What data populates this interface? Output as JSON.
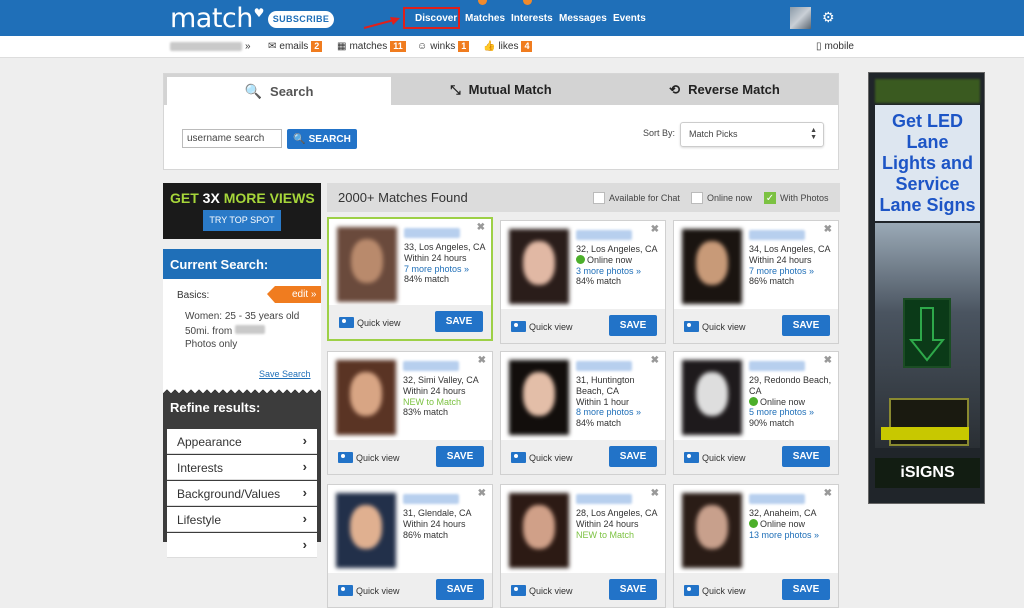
{
  "header": {
    "logo": "match",
    "subscribe": "SUBSCRIBE",
    "nav": [
      "Discover",
      "Matches",
      "Interests",
      "Messages",
      "Events"
    ]
  },
  "subnav": {
    "emails_label": "emails",
    "emails_count": "2",
    "matches_label": "matches",
    "matches_count": "11",
    "winks_label": "winks",
    "winks_count": "1",
    "likes_label": "likes",
    "likes_count": "4",
    "mobile": "mobile"
  },
  "search": {
    "tabs": [
      "Search",
      "Mutual Match",
      "Reverse Match"
    ],
    "username_placeholder": "username search",
    "button": "SEARCH",
    "sort_label": "Sort By:",
    "sort_value": "Match Picks"
  },
  "promo": {
    "headline_a": "GET",
    "headline_b": "3X",
    "headline_c": "MORE VIEWS",
    "button": "TRY TOP SPOT"
  },
  "current_search": {
    "title": "Current Search:",
    "basics": "Basics:",
    "edit": "edit »",
    "line1": "Women: 25 - 35 years old",
    "line2": "50mi. from",
    "line3": "Photos only",
    "save": "Save Search"
  },
  "refine": {
    "title": "Refine results:",
    "items": [
      "Appearance",
      "Interests",
      "Background/Values",
      "Lifestyle",
      ""
    ]
  },
  "results": {
    "count": "2000+ Matches Found",
    "filters": [
      "Available for Chat",
      "Online now",
      "With Photos"
    ],
    "quick_view": "Quick view",
    "save": "SAVE"
  },
  "cards": [
    {
      "a": "33, Los Angeles, CA",
      "b": "Within 24 hours",
      "c": "7 more photos »",
      "d": "84% match"
    },
    {
      "a": "32, Los Angeles, CA",
      "b": "Online now",
      "c": "3 more photos »",
      "d": "84% match"
    },
    {
      "a": "34, Los Angeles, CA",
      "b": "Within 24 hours",
      "c": "7 more photos »",
      "d": "86% match"
    },
    {
      "a": "32, Simi Valley, CA",
      "b": "Within 24 hours",
      "c": "NEW to Match",
      "d": "83% match"
    },
    {
      "a": "31, Huntington Beach, CA",
      "b": "Within 1 hour",
      "c": "8 more photos »",
      "d": "84% match"
    },
    {
      "a": "29, Redondo Beach, CA",
      "b": "Online now",
      "c": "5 more photos »",
      "d": "90% match"
    },
    {
      "a": "31, Glendale, CA",
      "b": "Within 24 hours",
      "c": "86% match",
      "d": ""
    },
    {
      "a": "28, Los Angeles, CA",
      "b": "Within 24 hours",
      "c": "NEW to Match",
      "d": ""
    },
    {
      "a": "32, Anaheim, CA",
      "b": "Online now",
      "c": "13 more photos »",
      "d": ""
    }
  ],
  "ad": {
    "headline": "Get LED Lane Lights and Service Lane Signs",
    "brand": "iSIGNS"
  }
}
